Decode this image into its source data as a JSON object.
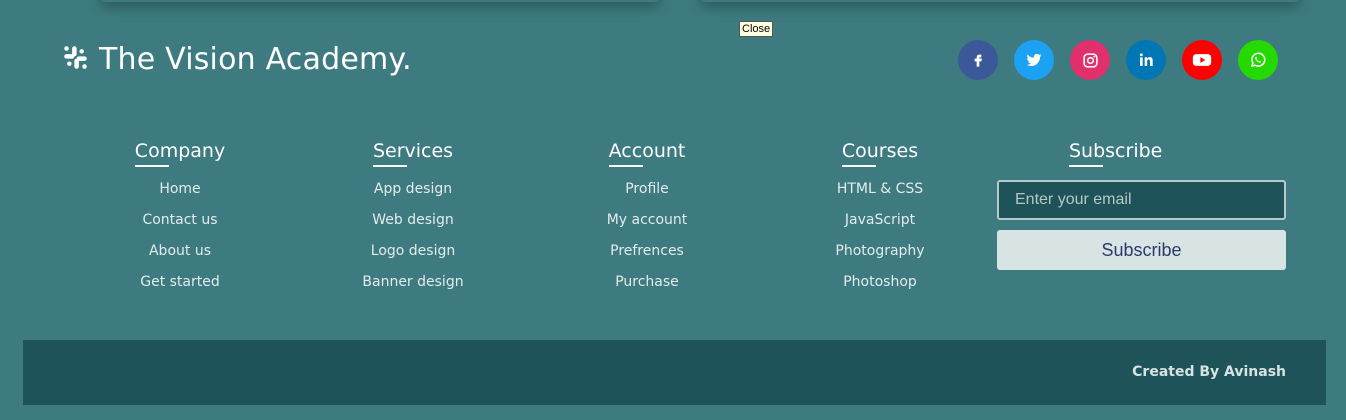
{
  "tooltip": "Close",
  "brand": {
    "name": "The Vision Academy.",
    "icon": "slack-icon"
  },
  "socials": [
    {
      "name": "facebook",
      "icon": "facebook-icon",
      "color": "#3b5998"
    },
    {
      "name": "twitter",
      "icon": "twitter-icon",
      "color": "#1da1f2"
    },
    {
      "name": "instagram",
      "icon": "instagram-icon",
      "color": "#e1306c"
    },
    {
      "name": "linkedin",
      "icon": "linkedin-icon",
      "color": "#0077b5"
    },
    {
      "name": "youtube",
      "icon": "youtube-icon",
      "color": "#ff0000"
    },
    {
      "name": "whatsapp",
      "icon": "whatsapp-icon",
      "color": "#25d900"
    }
  ],
  "columns": [
    {
      "title": "Company",
      "links": [
        "Home",
        "Contact us",
        "About us",
        "Get started"
      ]
    },
    {
      "title": "Services",
      "links": [
        "App design",
        "Web design",
        "Logo design",
        "Banner design"
      ]
    },
    {
      "title": "Account",
      "links": [
        "Profile",
        "My account",
        "Prefrences",
        "Purchase"
      ]
    },
    {
      "title": "Courses",
      "links": [
        "HTML & CSS",
        "JavaScript",
        "Photography",
        "Photoshop"
      ]
    }
  ],
  "subscribe": {
    "title": "Subscribe",
    "placeholder": "Enter your email",
    "button_label": "Subscribe"
  },
  "footer": {
    "credit": "Created By Avinash"
  },
  "colors": {
    "background": "#3d7b80",
    "bottom_bar": "#1e5359"
  }
}
